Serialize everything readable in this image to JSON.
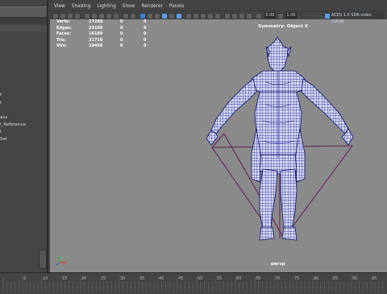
{
  "outliner": {
    "items": [
      "t",
      "t",
      "ass",
      "l_Reference",
      "t",
      "Set"
    ]
  },
  "menu": [
    "View",
    "Shading",
    "Lighting",
    "Show",
    "Renderer",
    "Panels"
  ],
  "toolbar": {
    "field1": "0.00",
    "field2": "1.00",
    "color_space": "ACES 1.0 SDR-video (sRGB"
  },
  "hud": {
    "rows": [
      {
        "label": "Verts:",
        "v1": "27288",
        "v2": "0",
        "v3": "0"
      },
      {
        "label": "Edges:",
        "v1": "23109",
        "v2": "0",
        "v3": "0"
      },
      {
        "label": "Faces:",
        "v1": "16189",
        "v2": "0",
        "v3": "0"
      },
      {
        "label": "Tris:",
        "v1": "31718",
        "v2": "0",
        "v3": "0"
      },
      {
        "label": "UVs:",
        "v1": "19456",
        "v2": "0",
        "v3": "0"
      }
    ]
  },
  "symmetry": "Symmetry: Object X",
  "camera": "persp",
  "timeline": {
    "labels": [
      "5",
      "10",
      "15",
      "20",
      "25",
      "30",
      "35",
      "40",
      "45",
      "50",
      "55",
      "60",
      "65",
      "70",
      "75",
      "80",
      "85",
      "90",
      "95"
    ]
  },
  "colors": {
    "viewport_bg": "#8a8a8a",
    "wireframe": "#1a1a9a",
    "selection_lines": "#6a2a5a"
  }
}
